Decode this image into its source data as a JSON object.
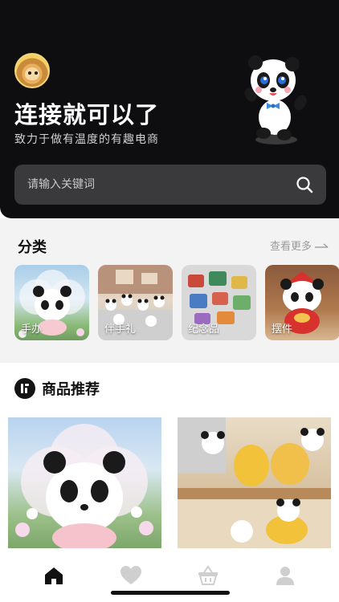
{
  "header": {
    "slogan": "连接就可以了",
    "subtitle": "致力于做有温度的有趣电商",
    "background": "#0e0e10"
  },
  "search": {
    "placeholder": "请输入关键词",
    "icon": "search-icon"
  },
  "categories": {
    "title": "分类",
    "more_label": "查看更多",
    "items": [
      {
        "label": "手办"
      },
      {
        "label": "伴手礼"
      },
      {
        "label": "纪念品"
      },
      {
        "label": "摆件"
      }
    ]
  },
  "recommend": {
    "title": "商品推荐",
    "icon": "recommend-icon"
  },
  "tabbar": {
    "items": [
      {
        "icon": "home-icon",
        "active": true
      },
      {
        "icon": "heart-icon",
        "active": false
      },
      {
        "icon": "basket-icon",
        "active": false
      },
      {
        "icon": "profile-icon",
        "active": false
      }
    ],
    "active_color": "#111111",
    "inactive_color": "#cfcfcf"
  }
}
